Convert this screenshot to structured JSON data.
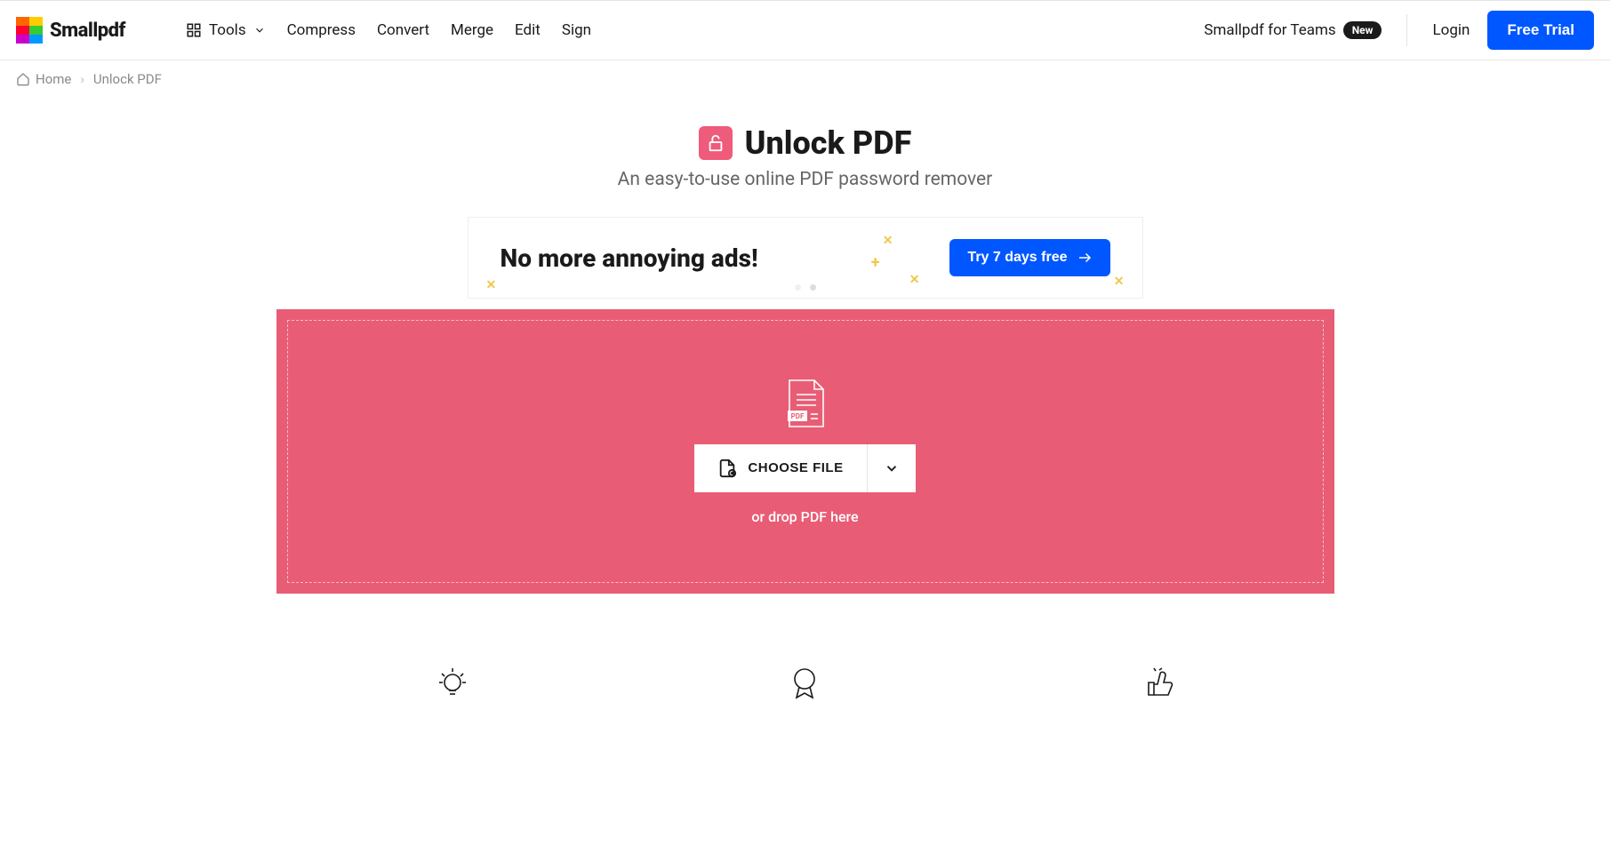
{
  "header": {
    "brand": "Smallpdf",
    "nav": {
      "tools": "Tools",
      "items": [
        "Compress",
        "Convert",
        "Merge",
        "Edit",
        "Sign"
      ]
    },
    "teams": "Smallpdf for Teams",
    "teams_badge": "New",
    "login": "Login",
    "free_trial": "Free Trial"
  },
  "breadcrumb": {
    "home": "Home",
    "current": "Unlock PDF"
  },
  "hero": {
    "title": "Unlock PDF",
    "subtitle": "An easy-to-use online PDF password remover"
  },
  "promo": {
    "headline": "No more annoying ads!",
    "cta": "Try 7 days free"
  },
  "dropzone": {
    "choose": "CHOOSE FILE",
    "hint": "or drop PDF here"
  }
}
